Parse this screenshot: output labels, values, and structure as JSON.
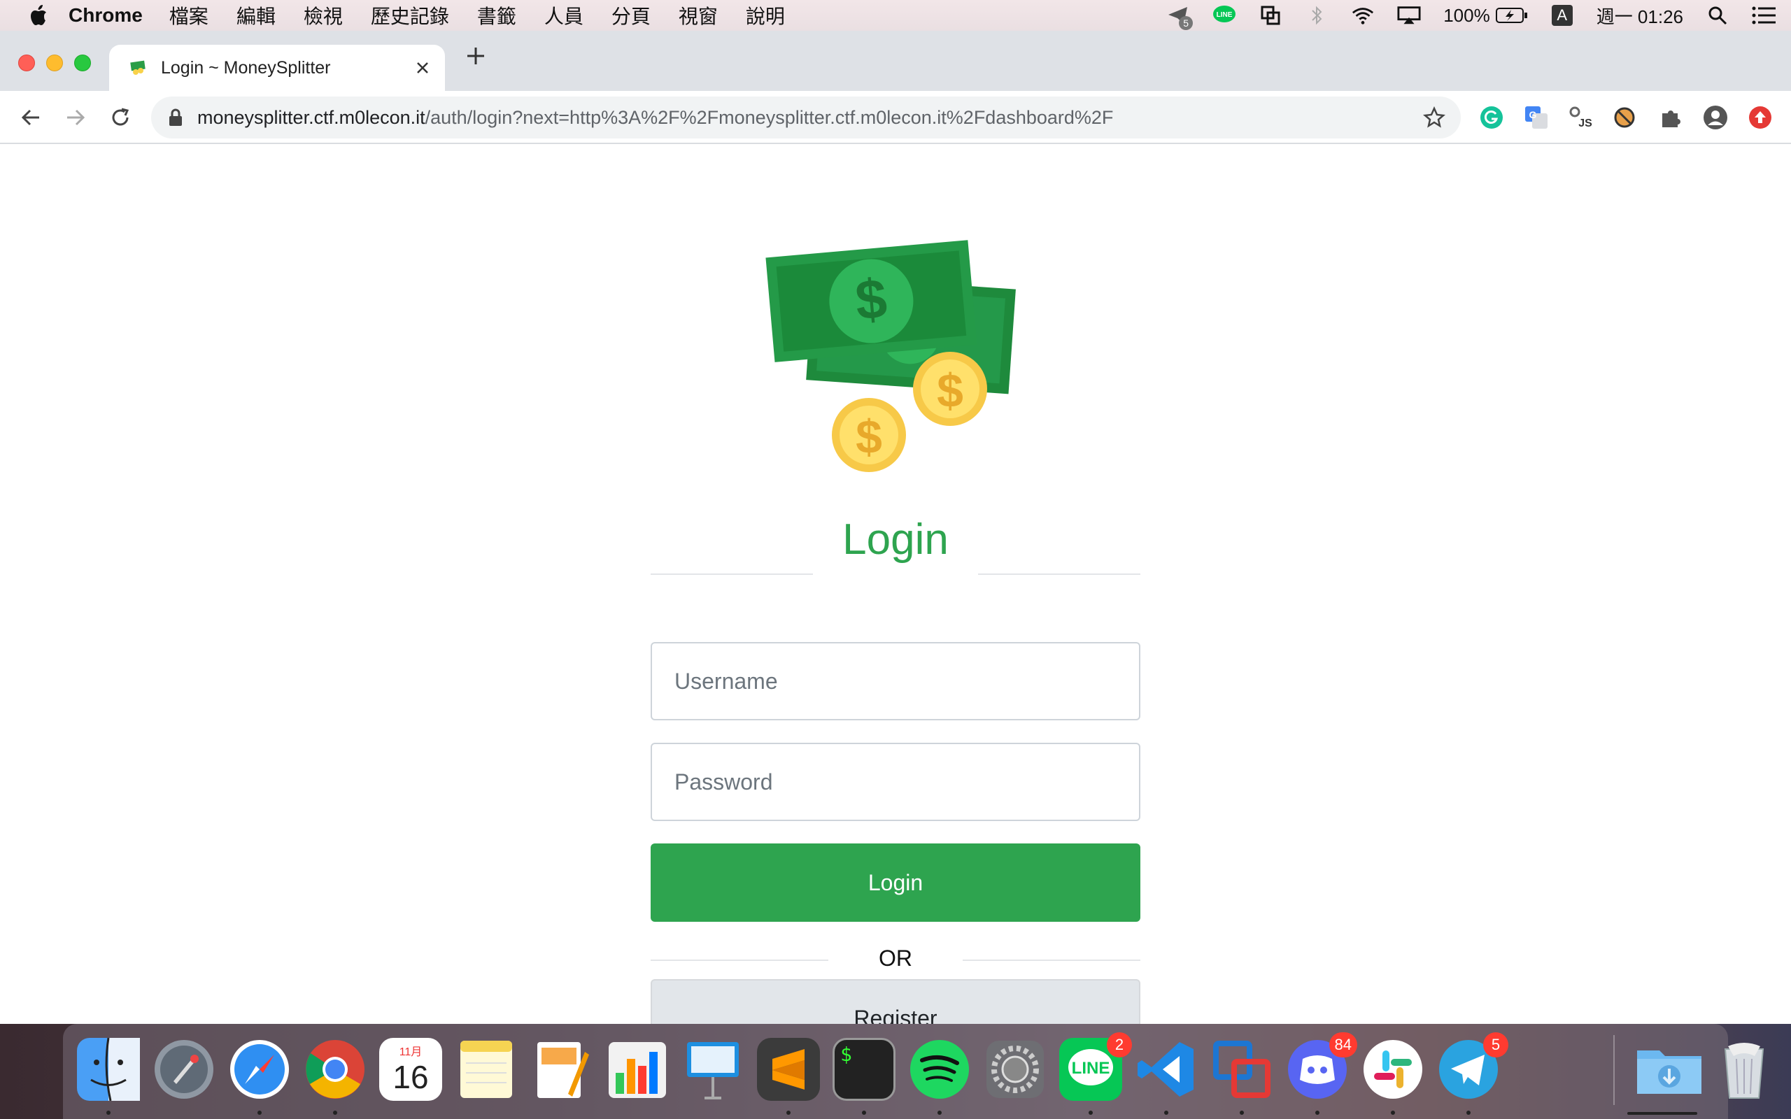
{
  "menubar": {
    "app_name": "Chrome",
    "items": [
      "檔案",
      "編輯",
      "檢視",
      "歷史記錄",
      "書籤",
      "人員",
      "分頁",
      "視窗",
      "說明"
    ],
    "battery": "100%",
    "input_method": "A",
    "clock": "週一 01:26",
    "status_icons": [
      "telegram-5-icon",
      "line-icon",
      "screen-icon",
      "bluetooth-icon",
      "wifi-icon",
      "airplay-icon",
      "battery-icon",
      "spotlight-icon",
      "notification-center-icon"
    ]
  },
  "browser": {
    "tab_title": "Login ~ MoneySplitter",
    "url_host": "moneysplitter.ctf.m0lecon.it",
    "url_path": "/auth/login?next=http%3A%2F%2Fmoneysplitter.ctf.m0lecon.it%2Fdashboard%2F",
    "extensions": [
      "grammarly-icon",
      "google-translate-icon",
      "js-extension-icon",
      "blocked-extension-icon",
      "puzzle-icon",
      "profile-icon",
      "update-icon"
    ]
  },
  "page": {
    "heading": "Login",
    "username_placeholder": "Username",
    "password_placeholder": "Password",
    "login_button": "Login",
    "or_text": "OR",
    "register_button": "Register"
  },
  "dock": {
    "apps": [
      "Finder",
      "Launchpad",
      "Safari",
      "Chrome",
      "Calendar",
      "Notes",
      "Pages",
      "Numbers",
      "Keynote",
      "Sublime Text",
      "Terminal",
      "Spotify",
      "System Preferences",
      "LINE",
      "VS Code",
      "VMware Fusion",
      "Discord",
      "Slack",
      "Telegram",
      "Downloads",
      "Trash"
    ],
    "calendar_month": "11月",
    "calendar_day": "16",
    "line_badge": "2",
    "discord_badge": "84",
    "telegram_badge": "5",
    "telegram_menubar_badge": "5",
    "line_label": "LINE",
    "terminal_prompt": "$"
  },
  "colors": {
    "accent_green": "#2ea44f",
    "register_gray": "#e2e6ea"
  }
}
